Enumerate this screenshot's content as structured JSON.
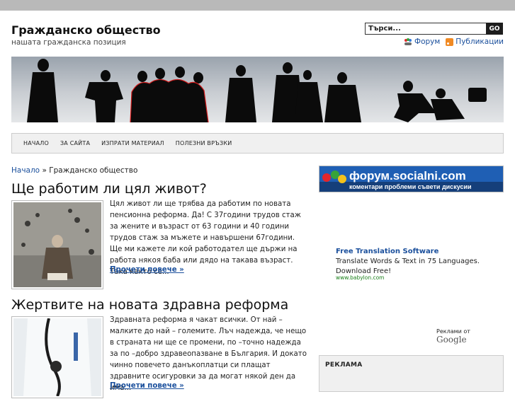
{
  "site": {
    "title": "Гражданско общество",
    "tagline": "нашата гражданска позиция"
  },
  "search": {
    "value": "Търси...",
    "button": "GO"
  },
  "toplinks": [
    {
      "label": "Форум",
      "icon": "forum-icon"
    },
    {
      "label": "Публикации",
      "icon": "rss-icon"
    }
  ],
  "nav": [
    "НАЧАЛО",
    "ЗА САЙТА",
    "ИЗПРАТИ МАТЕРИАЛ",
    "ПОЛЕЗНИ ВРЪЗКИ"
  ],
  "breadcrumb": {
    "home": "Начало",
    "separator": "»",
    "current": "Гражданско общество"
  },
  "posts": [
    {
      "title": "Ще работим ли цял живот?",
      "excerpt": "Цял живот ли ще трябва да работим по новата пенсионна реформа. Да! С 37години трудов стаж за жените и възраст от 63 години и 40 години трудов стаж за мъжете и навършени 67години. Ще ми кажете ли кой работодател ще държи на работа някоя баба или дядо на такава възраст. Така както се...",
      "more": "Прочети повече »"
    },
    {
      "title": "Жертвите на новата здравна реформа",
      "excerpt": "Здравната реформа я чакат всички. От най –малките до най – големите. Лъч надежда, че нещо в страната ни ще се промени, по –точно надежда за по –добро здравеопазване в България. И докато чинно повечето данъкоплатци си плащат здравните осигуровки за да могат някой ден да има...",
      "more": "Прочети повече »"
    }
  ],
  "sidebar": {
    "banner": {
      "brand": "форум.socialni.com",
      "tagline": "коментари проблеми съвети дискусии"
    },
    "ad": {
      "title": "Free Translation Software",
      "body": "Translate Words & Text in 75 Languages. Download Free!",
      "url": "www.babylon.com",
      "by_label": "Реклами от",
      "by_brand": "Google"
    },
    "widget_title": "РЕКЛАМА"
  },
  "colors": {
    "link": "#1a4f9c",
    "topbar": "#b9b9b9",
    "nav_bg": "#f0f0f0"
  }
}
